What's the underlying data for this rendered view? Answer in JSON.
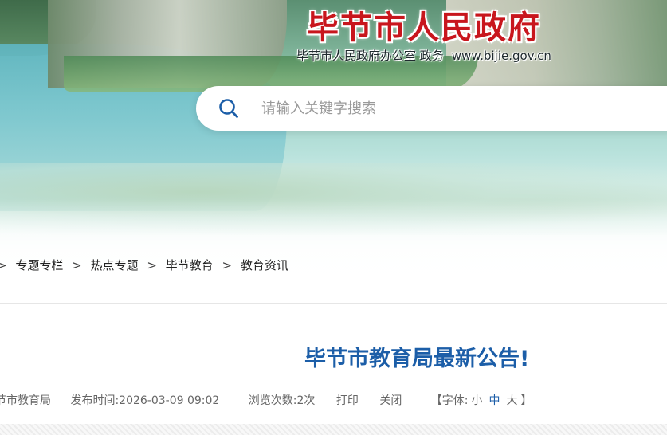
{
  "header": {
    "title": "毕节市人民政府",
    "subtitle": "毕节市人民政府办公室 政务",
    "domain": "www.bijie.gov.cn"
  },
  "search": {
    "placeholder": "请输入关键字搜索",
    "value": ""
  },
  "breadcrumb": {
    "items": [
      "专题专栏",
      "热点专题",
      "毕节教育",
      "教育资讯"
    ],
    "separator": ">"
  },
  "article": {
    "title": "毕节市教育局最新公告!",
    "source": "节市教育局",
    "publish_label": "发布时间:",
    "publish_time": "2026-03-09 09:02",
    "views_label": "浏览次数:",
    "views": "2次",
    "print_label": "打印",
    "close_label": "关闭",
    "font_label": "【字体:",
    "font_small": "小",
    "font_medium": "中",
    "font_large": "大",
    "font_end": "】"
  },
  "colors": {
    "title_red": "#c8161d",
    "article_blue": "#1c5ea8",
    "meta_gray": "#666666"
  },
  "icons": {
    "search": "search-icon"
  }
}
